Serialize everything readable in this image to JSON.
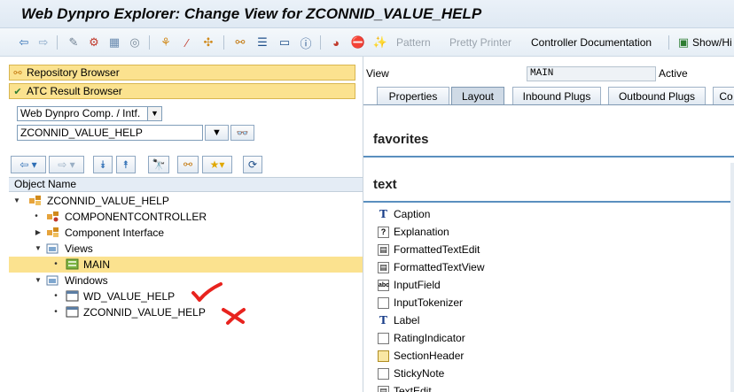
{
  "window": {
    "title": "Web Dynpro Explorer: Change View for ZCONNID_VALUE_HELP"
  },
  "toolbar": {
    "pattern_label": "Pattern",
    "pretty_printer_label": "Pretty Printer",
    "controller_doc_label": "Controller Documentation",
    "show_hide_label": "Show/Hi"
  },
  "navigation": {
    "repository_browser": "Repository Browser",
    "atc_result_browser": "ATC Result Browser",
    "object_type_value": "Web Dynpro Comp. / Intf.",
    "object_name_value": "ZCONNID_VALUE_HELP"
  },
  "tree": {
    "header": "Object Name",
    "nodes": [
      {
        "label": "ZCONNID_VALUE_HELP"
      },
      {
        "label": "COMPONENTCONTROLLER"
      },
      {
        "label": "Component Interface"
      },
      {
        "label": "Views"
      },
      {
        "label": "MAIN"
      },
      {
        "label": "Windows"
      },
      {
        "label": "WD_VALUE_HELP"
      },
      {
        "label": "ZCONNID_VALUE_HELP"
      }
    ]
  },
  "editor": {
    "view_label": "View",
    "view_value": "MAIN",
    "status": "Active",
    "tabs": [
      {
        "label": "Properties"
      },
      {
        "label": "Layout"
      },
      {
        "label": "Inbound Plugs"
      },
      {
        "label": "Outbound Plugs"
      },
      {
        "label": "Co"
      }
    ],
    "active_tab": "Layout"
  },
  "ui_library": {
    "favorites_title": "favorites",
    "text_title": "text",
    "items": [
      {
        "label": "Caption",
        "icon": "caption-icon"
      },
      {
        "label": "Explanation",
        "icon": "explanation-icon"
      },
      {
        "label": "FormattedTextEdit",
        "icon": "formatted-text-edit-icon"
      },
      {
        "label": "FormattedTextView",
        "icon": "formatted-text-view-icon"
      },
      {
        "label": "InputField",
        "icon": "input-field-icon"
      },
      {
        "label": "InputTokenizer",
        "icon": "input-tokenizer-icon"
      },
      {
        "label": "Label",
        "icon": "label-icon"
      },
      {
        "label": "RatingIndicator",
        "icon": "rating-indicator-icon"
      },
      {
        "label": "SectionHeader",
        "icon": "section-header-icon"
      },
      {
        "label": "StickyNote",
        "icon": "sticky-note-icon"
      },
      {
        "label": "TextEdit",
        "icon": "text-edit-icon"
      }
    ]
  },
  "colors": {
    "selection": "#fbe28f",
    "section_rule": "#5a8fbf",
    "annotation_red": "#e8231e"
  }
}
